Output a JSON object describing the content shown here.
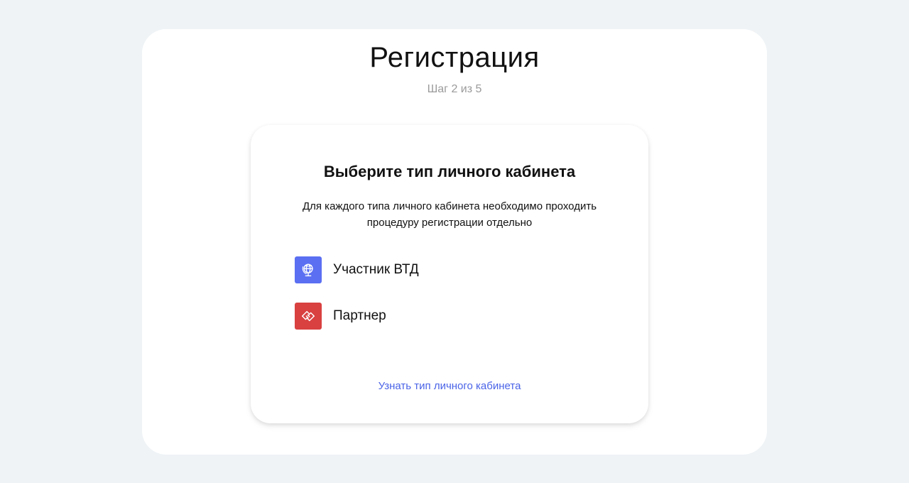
{
  "page": {
    "title": "Регистрация",
    "step": "Шаг 2 из 5"
  },
  "card": {
    "title": "Выберите тип личного кабинета",
    "description": "Для каждого типа личного кабинета необходимо проходить процедуру регистрации отдельно",
    "options": [
      {
        "label": "Участник ВТД",
        "icon": "globe-icon",
        "color": "#5b6ff2"
      },
      {
        "label": "Партнер",
        "icon": "handshake-icon",
        "color": "#d94040"
      }
    ],
    "link": {
      "label": "Узнать тип личного кабинета",
      "color": "#4a63e7"
    }
  }
}
